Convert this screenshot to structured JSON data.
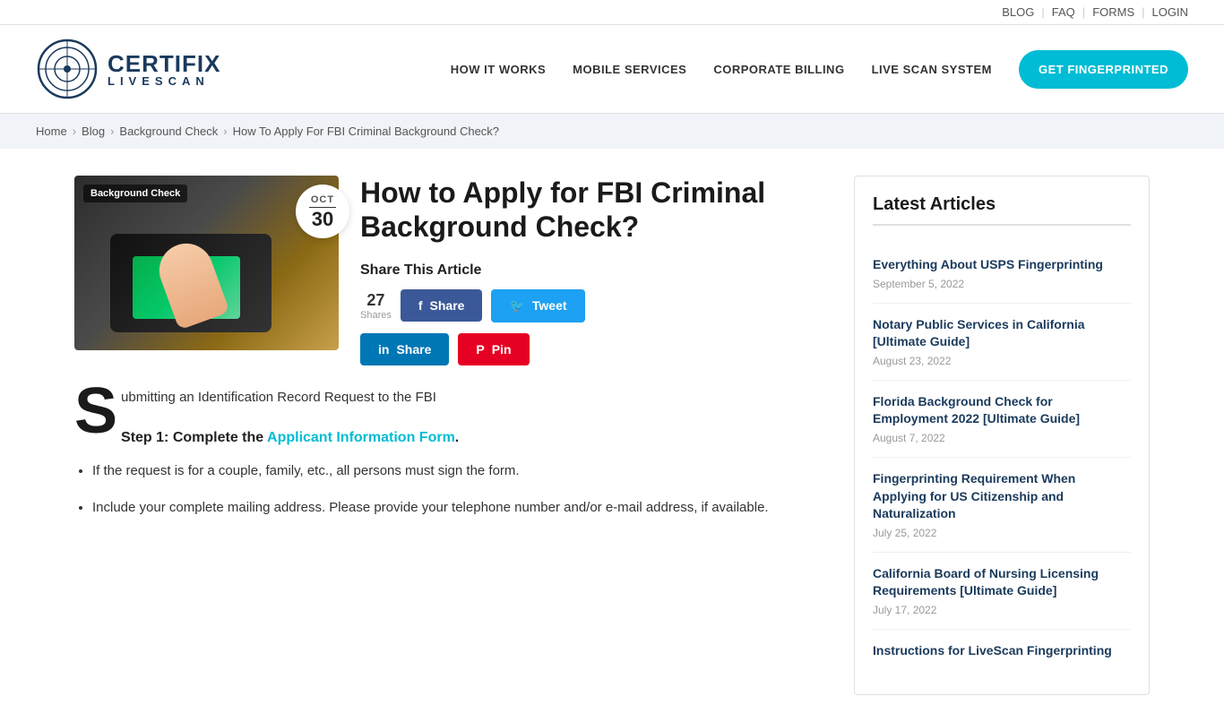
{
  "topbar": {
    "blog": "BLOG",
    "faq": "FAQ",
    "forms": "FORMS",
    "login": "LOGIN"
  },
  "header": {
    "logo_certifix": "CERTIFIX",
    "logo_livescan": "LIVESCAN",
    "nav": {
      "how_it_works": "HOW IT WORKS",
      "mobile_services": "MOBILE SERVICES",
      "corporate_billing": "CORPORATE BILLING",
      "live_scan_system": "LIVE SCAN SYSTEM",
      "get_fingerprinted": "GET FINGERPRINTED"
    }
  },
  "breadcrumb": {
    "home": "Home",
    "blog": "Blog",
    "background_check": "Background Check",
    "current": "How To Apply For FBI Criminal Background Check?"
  },
  "article": {
    "badge": "Background Check",
    "date_month": "OCT",
    "date_day": "30",
    "title": "How to Apply for FBI Criminal Background Check?",
    "share_heading": "Share This Article",
    "shares_count": "27",
    "shares_label": "Shares",
    "btn_share_facebook": "Share",
    "btn_tweet": "Tweet",
    "btn_share_linkedin": "Share",
    "btn_pin": "Pin",
    "drop_cap": "S",
    "intro_text": "ubmitting an Identification Record Request to the FBI",
    "step1_prefix": "Step 1: Complete the ",
    "step1_link": "Applicant Information Form",
    "step1_suffix": ".",
    "bullet1": "If the request is for a couple, family, etc., all persons must sign the form.",
    "bullet2": "Include your complete mailing address. Please provide your telephone number and/or e-mail address, if available."
  },
  "sidebar": {
    "title": "Latest Articles",
    "articles": [
      {
        "title": "Everything About USPS Fingerprinting",
        "date": "September 5, 2022"
      },
      {
        "title": "Notary Public Services in California [Ultimate Guide]",
        "date": "August 23, 2022"
      },
      {
        "title": "Florida Background Check for Employment 2022 [Ultimate Guide]",
        "date": "August 7, 2022"
      },
      {
        "title": "Fingerprinting Requirement When Applying for US Citizenship and Naturalization",
        "date": "July 25, 2022"
      },
      {
        "title": "California Board of Nursing Licensing Requirements [Ultimate Guide]",
        "date": "July 17, 2022"
      },
      {
        "title": "Instructions for LiveScan Fingerprinting",
        "date": ""
      }
    ]
  }
}
